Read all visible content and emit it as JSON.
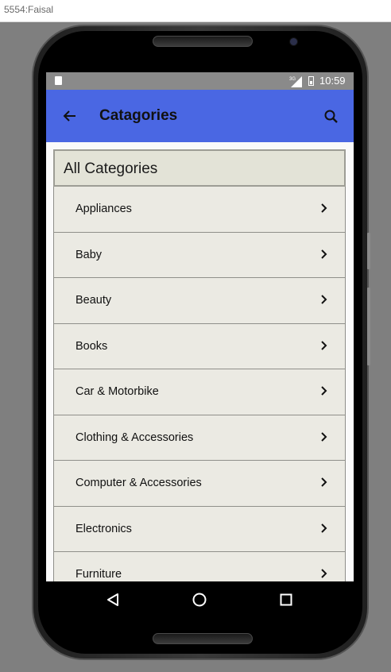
{
  "window": {
    "title": "5554:Faisal"
  },
  "statusbar": {
    "network": "3G",
    "time": "10:59"
  },
  "appbar": {
    "title": "Catagories"
  },
  "card": {
    "header": "All Categories",
    "items": [
      {
        "label": "Appliances"
      },
      {
        "label": "Baby"
      },
      {
        "label": "Beauty"
      },
      {
        "label": "Books"
      },
      {
        "label": "Car & Motorbike"
      },
      {
        "label": "Clothing & Accessories"
      },
      {
        "label": "Computer & Accessories"
      },
      {
        "label": "Electronics"
      },
      {
        "label": "Furniture"
      }
    ]
  },
  "icons": {
    "back": "arrow-left-icon",
    "search": "search-icon",
    "chevron": "chevron-right-icon",
    "nav_back": "triangle-back-icon",
    "nav_home": "circle-home-icon",
    "nav_recent": "square-recent-icon"
  },
  "colors": {
    "appbar": "#4a67e3",
    "statusbar": "#8a8a8a",
    "card": "#ebeae3",
    "card_header": "#e3e3d7"
  }
}
